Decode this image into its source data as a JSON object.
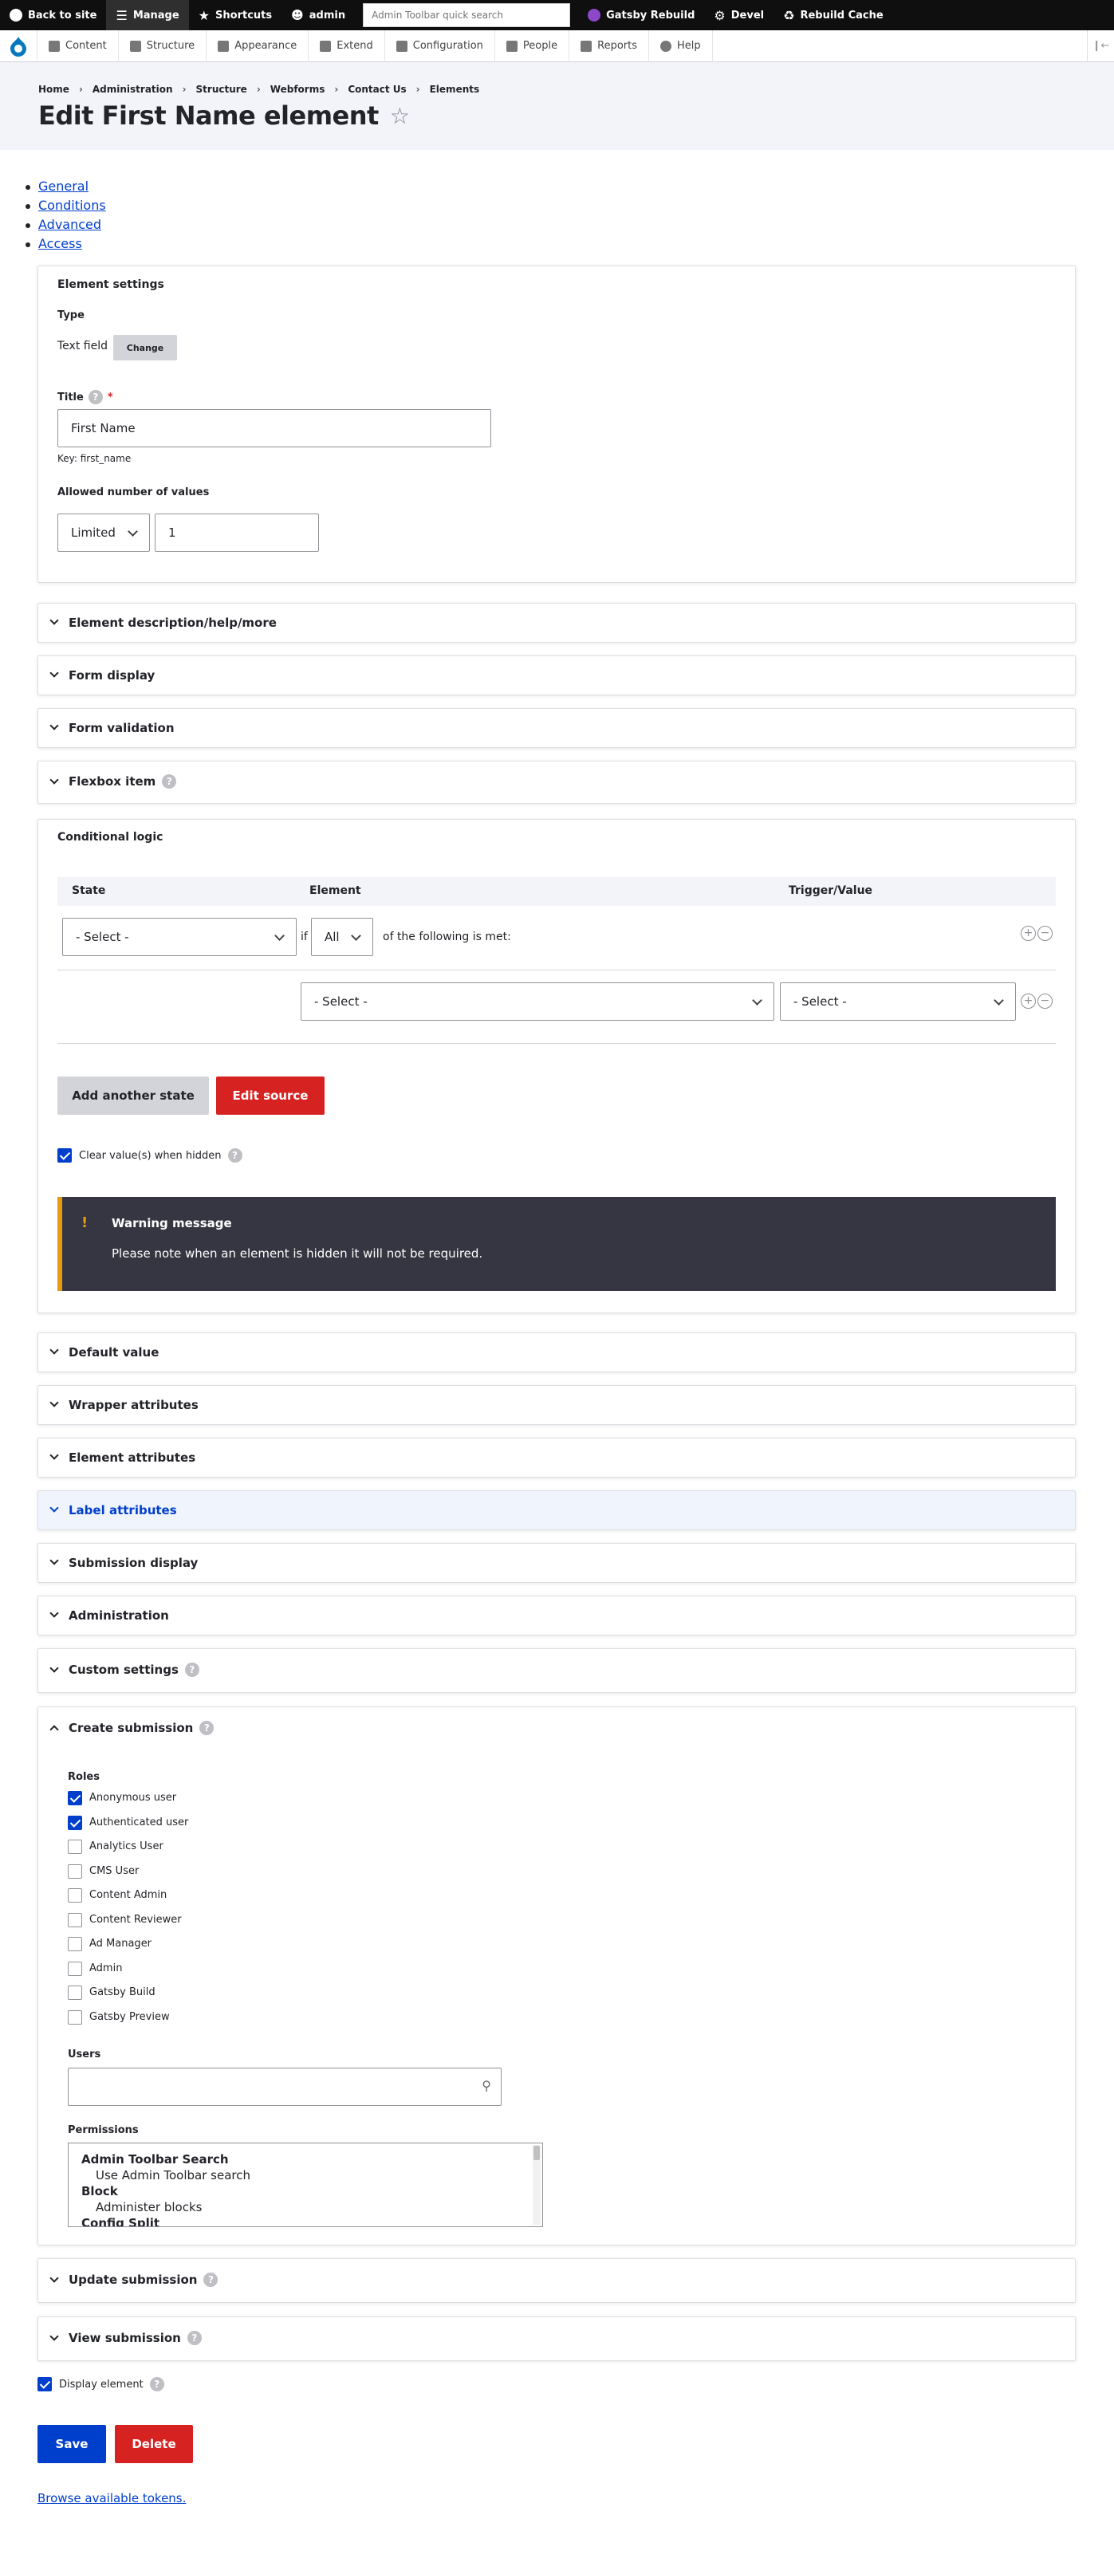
{
  "toolbar": {
    "back": "Back to site",
    "manage": "Manage",
    "shortcuts": "Shortcuts",
    "user": "admin",
    "search_placeholder": "Admin Toolbar quick search",
    "gatsby": "Gatsby Rebuild",
    "devel": "Devel",
    "cache": "Rebuild Cache"
  },
  "tray": {
    "items": [
      "Content",
      "Structure",
      "Appearance",
      "Extend",
      "Configuration",
      "People",
      "Reports",
      "Help"
    ]
  },
  "breadcrumb": [
    "Home",
    "Administration",
    "Structure",
    "Webforms",
    "Contact Us",
    "Elements"
  ],
  "page_title": "Edit First Name element",
  "tabs": [
    "General",
    "Conditions",
    "Advanced",
    "Access"
  ],
  "element_settings": {
    "legend": "Element settings",
    "type_label": "Type",
    "type_value": "Text field",
    "change": "Change",
    "title_label": "Title",
    "required_mark": "*",
    "title_value": "First Name",
    "key": "Key: first_name",
    "allowed_label": "Allowed number of values",
    "limited": "Limited",
    "count": "1"
  },
  "sections": [
    "Element description/help/more",
    "Form display",
    "Form validation",
    "Flexbox item"
  ],
  "conditional": {
    "legend": "Conditional logic",
    "col_state": "State",
    "col_element": "Element",
    "col_trigger": "Trigger/Value",
    "state_select": "- Select -",
    "if": "if",
    "all": "All",
    "following": "of the following is met:",
    "element_select": "- Select -",
    "trigger_select": "- Select -",
    "add_state": "Add another state",
    "edit_source": "Edit source",
    "clear_values": "Clear value(s) when hidden",
    "warning_title": "Warning message",
    "warning_text": "Please note when an element is hidden it will not be required."
  },
  "sections2": [
    "Default value",
    "Wrapper attributes",
    "Element attributes",
    "Label attributes",
    "Submission display",
    "Administration",
    "Custom settings"
  ],
  "create": {
    "legend": "Create submission",
    "roles_label": "Roles",
    "roles": [
      {
        "label": "Anonymous user",
        "checked": true
      },
      {
        "label": "Authenticated user",
        "checked": true
      },
      {
        "label": "Analytics User",
        "checked": false
      },
      {
        "label": "CMS User",
        "checked": false
      },
      {
        "label": "Content Admin",
        "checked": false
      },
      {
        "label": "Content Reviewer",
        "checked": false
      },
      {
        "label": "Ad Manager",
        "checked": false
      },
      {
        "label": "Admin",
        "checked": false
      },
      {
        "label": "Gatsby Build",
        "checked": false
      },
      {
        "label": "Gatsby Preview",
        "checked": false
      }
    ],
    "users_label": "Users",
    "permissions_label": "Permissions",
    "permissions": [
      "Admin Toolbar Search",
      "Use Admin Toolbar search",
      "Block",
      "Administer blocks",
      "Config Split"
    ]
  },
  "sections3": [
    "Update submission",
    "View submission"
  ],
  "display_element": "Display element",
  "save": "Save",
  "delete": "Delete",
  "tokens": "Browse available tokens.",
  "help_mark": "?"
}
